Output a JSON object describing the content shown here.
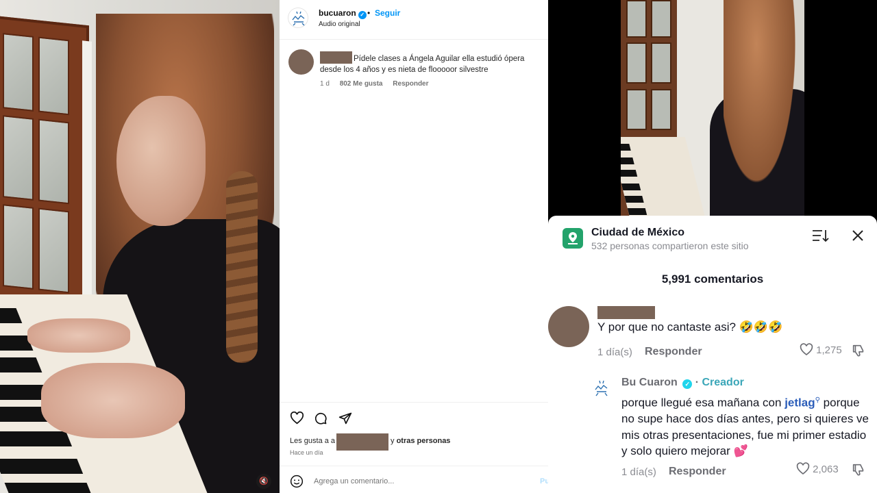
{
  "instagram": {
    "header": {
      "username": "bucuaron",
      "verified_glyph": "✓",
      "separator": "•",
      "follow_label": "Seguir",
      "audio_label": "Audio original"
    },
    "comment": {
      "text": "Pídele clases a Ángela Aguilar ella estudió ópera desde los 4 años y es nieta de flooooor silvestre",
      "age": "1 d",
      "likes": "802 Me gusta",
      "reply_label": "Responder"
    },
    "actions": [
      "heart-icon",
      "comment-icon",
      "share-icon"
    ],
    "likes_text": {
      "prefix": "Les gusta a",
      "suffix": "y",
      "others": "otras personas"
    },
    "post_time": "Hace un día",
    "add_comment_placeholder": "Agrega un comentario...",
    "post_label": "Pu"
  },
  "left_video": {
    "mute_glyph": "🔇"
  },
  "tiktok": {
    "location": {
      "title": "Ciudad de México",
      "subtitle": "532 personas compartieron este sitio"
    },
    "comment_count": "5,991 comentarios",
    "comments": [
      {
        "text": "Y por que no cantaste asi? 🤣🤣🤣",
        "time": "1 día(s)",
        "reply_label": "Responder",
        "likes": "1,275"
      },
      {
        "author": "Bu Cuaron",
        "verified_glyph": "✓",
        "separator": "·",
        "badge": "Creador",
        "text_before_link": "porque llegué esa mañana con",
        "link": "jetlag",
        "text_after_link": "porque no supe hace dos días antes, pero si quieres ve mis otras presentaciones, fue mi primer estadio y solo quiero mejorar 💕",
        "time": "1 día(s)",
        "reply_label": "Responder",
        "likes": "2,063"
      }
    ]
  },
  "colors": {
    "ig_blue": "#0095f6",
    "tt_location_green": "#23a36b",
    "redaction": "#7a6457",
    "creator_teal": "#3aa6b8",
    "link_blue": "#2b5db9"
  }
}
